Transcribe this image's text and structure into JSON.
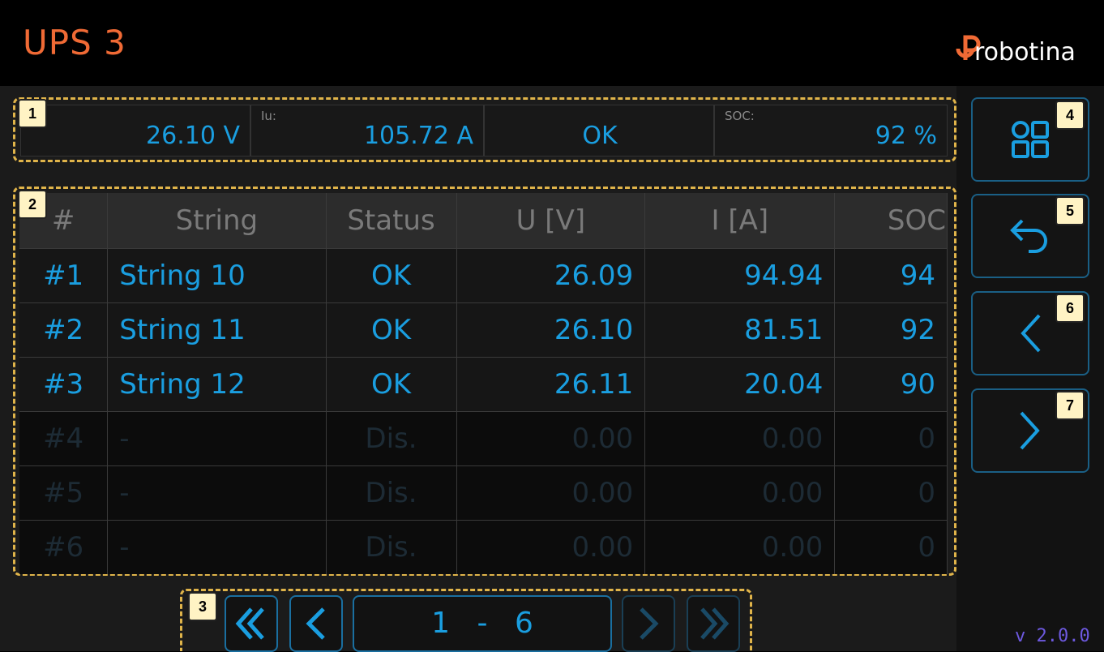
{
  "header": {
    "title": "UPS 3",
    "logo_text": "robotina"
  },
  "summary": {
    "u_value": "26.10 V",
    "i_label": "Iu:",
    "i_value": "105.72 A",
    "status_value": "OK",
    "soc_label": "SOC:",
    "soc_value": "92 %"
  },
  "table": {
    "columns": [
      "#",
      "String",
      "Status",
      "U [V]",
      "I [A]",
      "SOC"
    ],
    "rows": [
      {
        "num": "#1",
        "string": "String 10",
        "status": "OK",
        "u": "26.09",
        "i": "94.94",
        "soc": "94"
      },
      {
        "num": "#2",
        "string": "String 11",
        "status": "OK",
        "u": "26.10",
        "i": "81.51",
        "soc": "92"
      },
      {
        "num": "#3",
        "string": "String 12",
        "status": "OK",
        "u": "26.11",
        "i": "20.04",
        "soc": "90"
      },
      {
        "num": "#4",
        "string": "-",
        "status": "Dis.",
        "u": "0.00",
        "i": "0.00",
        "soc": "0"
      },
      {
        "num": "#5",
        "string": "-",
        "status": "Dis.",
        "u": "0.00",
        "i": "0.00",
        "soc": "0"
      },
      {
        "num": "#6",
        "string": "-",
        "status": "Dis.",
        "u": "0.00",
        "i": "0.00",
        "soc": "0"
      }
    ]
  },
  "pager": {
    "range": "1 - 6"
  },
  "sidebar": {
    "icons": [
      "dashboard-icon",
      "back-icon",
      "chevron-left-icon",
      "chevron-right-icon"
    ]
  },
  "badges": [
    "1",
    "2",
    "3",
    "4",
    "5",
    "6",
    "7"
  ],
  "version": "v 2.0.0",
  "colors": {
    "accent": "#1a9ee0",
    "title": "#f06a35",
    "badge_border": "#e0b44a",
    "version": "#6d59e0"
  }
}
